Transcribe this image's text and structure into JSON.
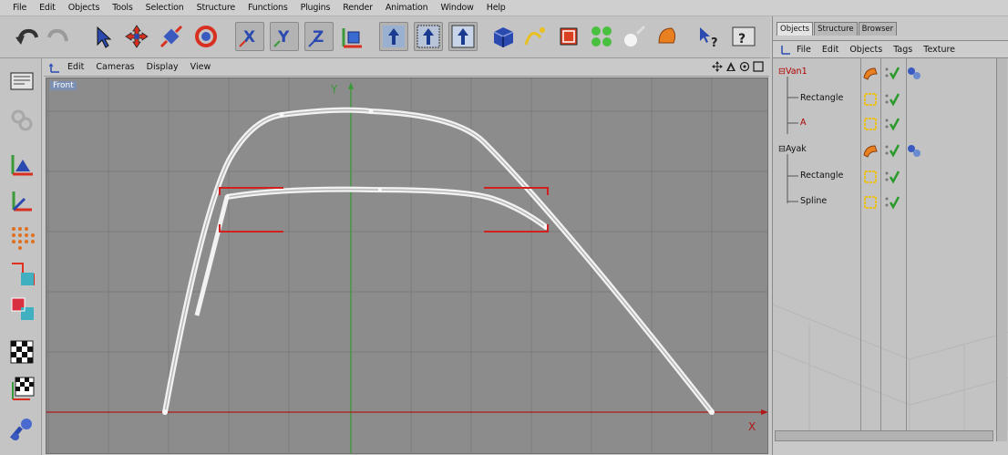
{
  "menu": [
    "File",
    "Edit",
    "Objects",
    "Tools",
    "Selection",
    "Structure",
    "Functions",
    "Plugins",
    "Render",
    "Animation",
    "Window",
    "Help"
  ],
  "toolbar": {
    "icons": [
      "undo-icon",
      "redo-icon",
      "live-select-icon",
      "move-icon",
      "scale-icon",
      "rotate-icon",
      "x-axis-lock-icon",
      "y-axis-lock-icon",
      "z-axis-lock-icon",
      "coordinate-system-icon",
      "render-view-icon",
      "render-region-icon",
      "render-picture-viewer-icon",
      "cube-primitive-icon",
      "spline-pen-icon",
      "nurbs-icon",
      "array-icon",
      "light-icon",
      "deformer-icon",
      "help-cursor-icon",
      "render-settings-icon"
    ]
  },
  "viewport": {
    "menu": [
      "Edit",
      "Cameras",
      "Display",
      "View"
    ],
    "view_name": "Front",
    "axis_y": "Y",
    "axis_x": "X"
  },
  "right_panel": {
    "tabs": [
      "Objects",
      "Structure",
      "Browser"
    ],
    "menu": [
      "File",
      "Edit",
      "Objects",
      "Tags",
      "Texture"
    ],
    "objects": [
      {
        "name": "Van1",
        "color": "#b00000",
        "indent": 0,
        "expand": "⊟",
        "type": "extrude"
      },
      {
        "name": "Rectangle",
        "color": "#111111",
        "indent": 1,
        "type": "spline"
      },
      {
        "name": "A",
        "color": "#b00000",
        "indent": 1,
        "type": "spline"
      },
      {
        "name": "Ayak",
        "color": "#111111",
        "indent": 0,
        "expand": "⊟",
        "type": "extrude"
      },
      {
        "name": "Rectangle",
        "color": "#111111",
        "indent": 1,
        "type": "spline"
      },
      {
        "name": "Spline",
        "color": "#111111",
        "indent": 1,
        "type": "spline"
      }
    ]
  },
  "colors": {
    "viewport_bg": "#8c8c8c",
    "grid": "#7a7a7a",
    "y_axis": "#3a9a3a",
    "x_axis": "#b01818",
    "spline": "#f2f2f2",
    "selection": "#d02020"
  }
}
